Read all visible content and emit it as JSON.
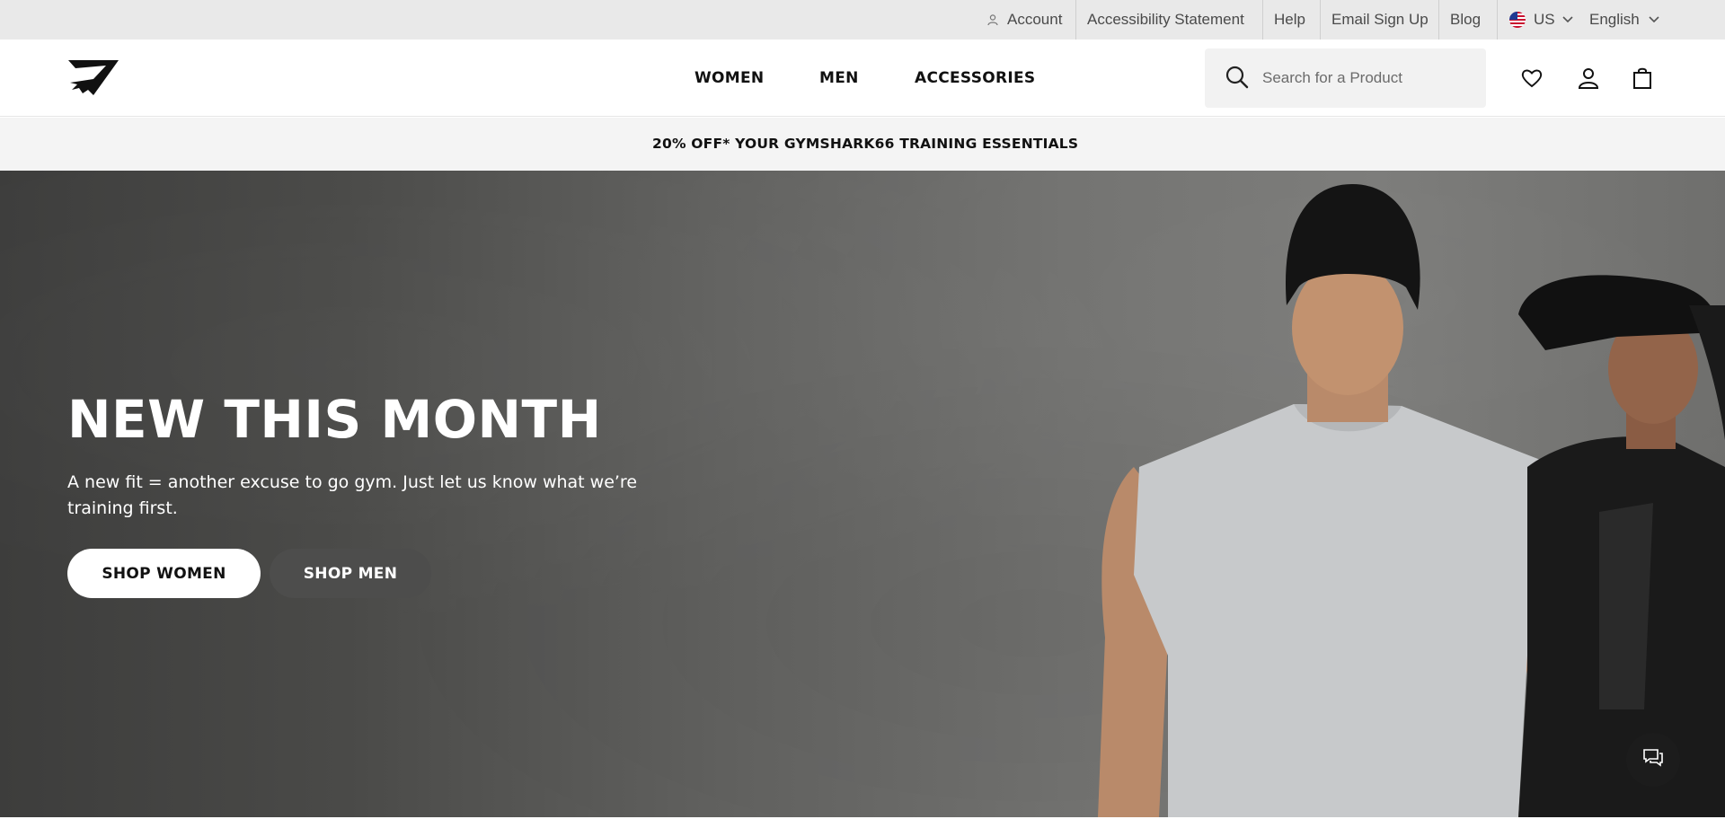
{
  "utility_bar": {
    "account_label": "Account",
    "accessibility_label": "Accessibility Statement",
    "help_label": "Help",
    "email_signup_label": "Email Sign Up",
    "blog_label": "Blog",
    "region_label": "US",
    "language_label": "English",
    "icons": [
      "person-icon",
      "us-flag-icon",
      "chevron-down-icon"
    ]
  },
  "header": {
    "logo_name": "gymshark-logo",
    "nav": [
      "WOMEN",
      "MEN",
      "ACCESSORIES"
    ],
    "search": {
      "placeholder": "Search for a Product",
      "value": ""
    },
    "icons": [
      "search-icon",
      "heart-icon",
      "user-icon",
      "bag-icon"
    ]
  },
  "promo": {
    "text": "20% OFF* YOUR GYMSHARK66 TRAINING ESSENTIALS"
  },
  "hero": {
    "title": "NEW THIS MONTH",
    "subtitle": "A new fit = another excuse to go gym. Just let us know what we’re training first.",
    "primary_button": "SHOP WOMEN",
    "secondary_button": "SHOP MEN",
    "image_description_icon": "hero-models-image"
  },
  "chat": {
    "icon": "chat-icon"
  },
  "colors": {
    "utility_bg": "#e9e9e9",
    "promo_bg": "#f4f4f4",
    "search_bg": "#f2f2f2",
    "hero_dark": "#3d3d3c",
    "hero_light": "#7c7c7a",
    "button_secondary": "#4d4d4c",
    "chat_bg": "#1c1c1c"
  }
}
